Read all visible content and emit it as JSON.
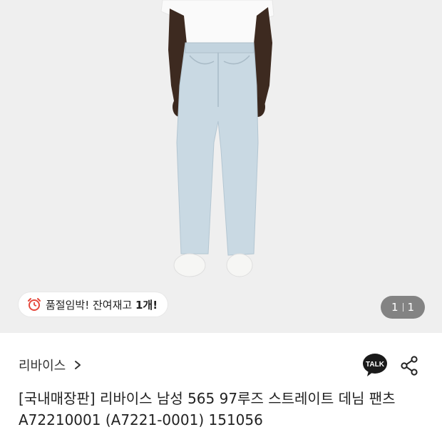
{
  "product": {
    "stock_notice_prefix": "품절임박! 잔여재고 ",
    "stock_notice_count": "1개!",
    "pager_current": "1",
    "pager_total": "1",
    "brand": "리바이스",
    "title": "[국내매장판] 리바이스 남성 565 97루즈 스트레이트 데님 팬츠 A72210001 (A7221-0001) 151056"
  },
  "icons": {
    "stock": "alarm-clock-icon",
    "brand": "chevron-right-icon",
    "talk": "kakao-talk-icon",
    "share": "share-icon"
  },
  "colors": {
    "hero_bg": "#efefef",
    "jeans": "#c9d9e3",
    "pager_bg": "rgba(0,0,0,0.45)",
    "talk_bubble": "#1a1a1a"
  }
}
